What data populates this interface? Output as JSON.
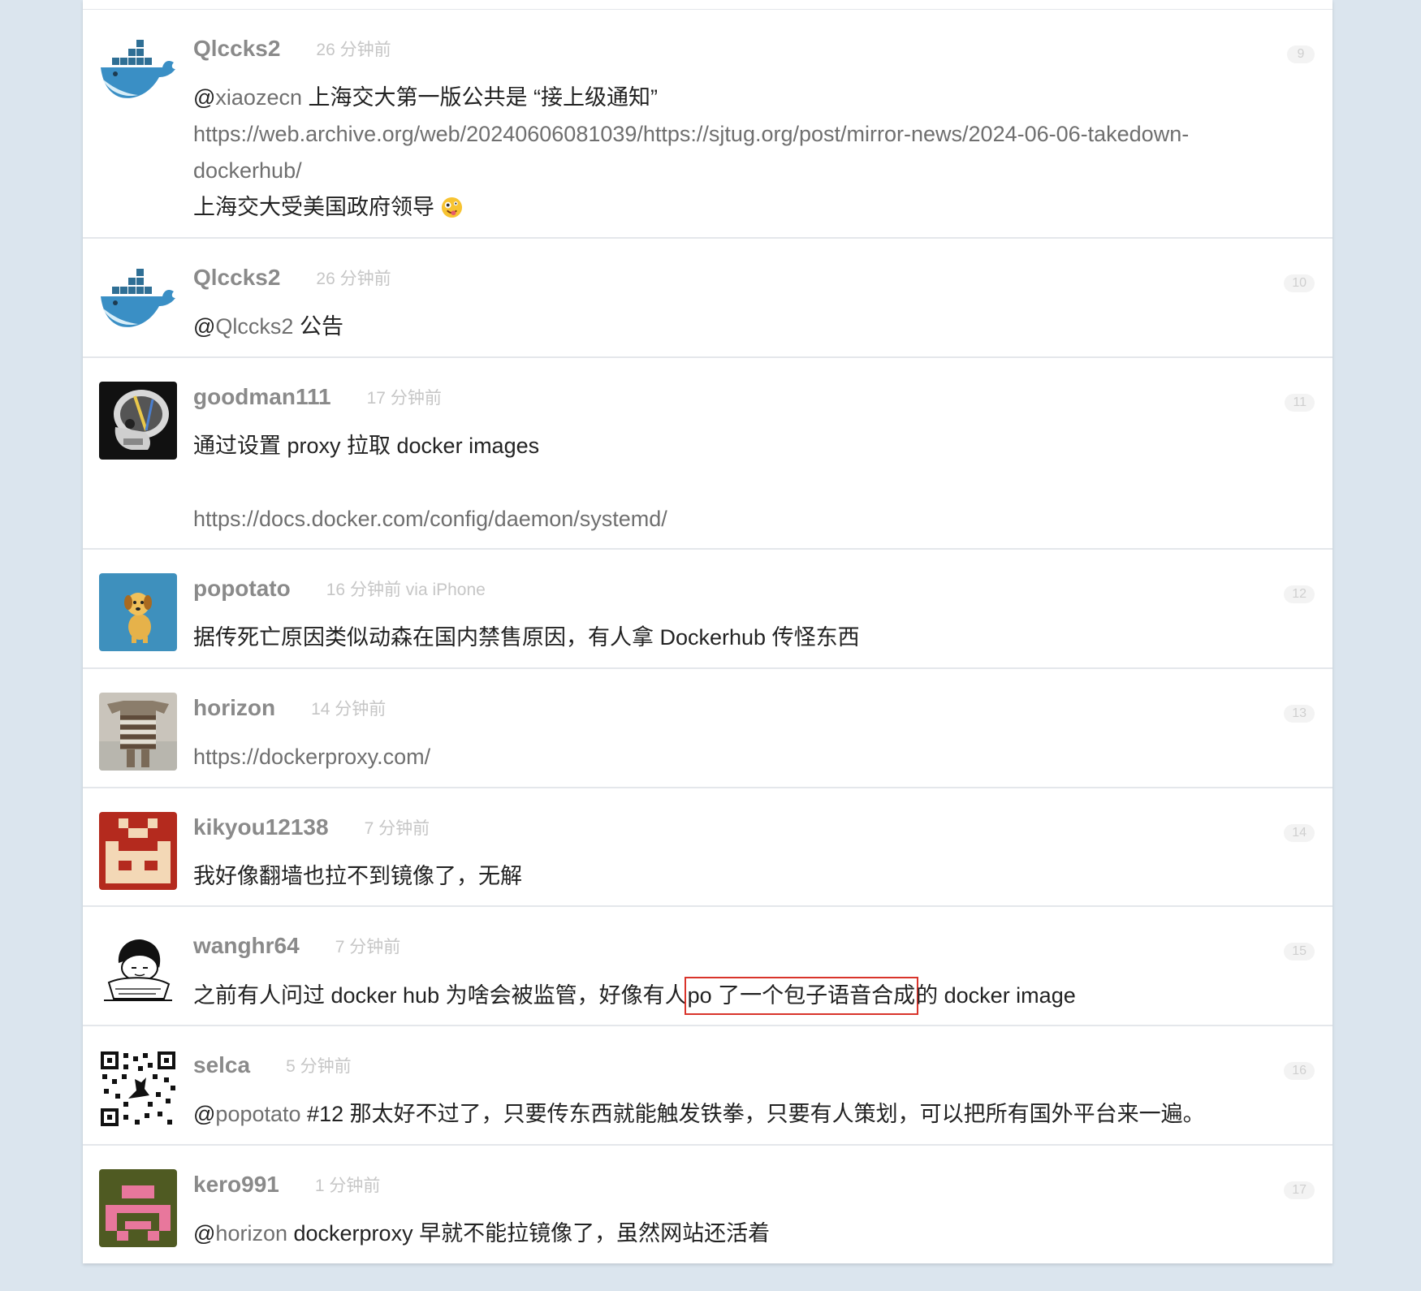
{
  "replies": [
    {
      "username": "Qlccks2",
      "time": "26 分钟前",
      "floor": "9",
      "mention": "xiaozecn",
      "text1": "上海交大第一版公共是 “接上级通知”",
      "link_part1": "https://web.archive.org/web/20240606081039/https://sjtug.org/post/mirror-news/2024-06-06-takedown-",
      "link_part2": "dockerhub/",
      "text2": "上海交大受美国政府领导"
    },
    {
      "username": "Qlccks2",
      "time": "26 分钟前",
      "floor": "10",
      "mention": "Qlccks2",
      "text": "公告"
    },
    {
      "username": "goodman111",
      "time": "17 分钟前",
      "floor": "11",
      "text": "通过设置 proxy 拉取 docker images",
      "link": "https://docs.docker.com/config/daemon/systemd/"
    },
    {
      "username": "popotato",
      "time": "16 分钟前 via iPhone",
      "floor": "12",
      "text": "据传死亡原因类似动森在国内禁售原因，有人拿 Dockerhub 传怪东西"
    },
    {
      "username": "horizon",
      "time": "14 分钟前",
      "floor": "13",
      "link": "https://dockerproxy.com/"
    },
    {
      "username": "kikyou12138",
      "time": "7 分钟前",
      "floor": "14",
      "text": "我好像翻墙也拉不到镜像了，无解"
    },
    {
      "username": "wanghr64",
      "time": "7 分钟前",
      "floor": "15",
      "text_before": "之前有人问过 docker hub 为啥会被监管，好像有人",
      "text_highlight": "po 了一个包子语音合成",
      "text_after": "的 docker image"
    },
    {
      "username": "selca",
      "time": "5 分钟前",
      "floor": "16",
      "mention": "popotato",
      "text": "#12 那太好不过了，只要传东西就能触发铁拳，只要有人策划，可以把所有国外平台来一遍。"
    },
    {
      "username": "kero991",
      "time": "1 分钟前",
      "floor": "17",
      "mention": "horizon",
      "text": "dockerproxy 早就不能拉镜像了，虽然网站还活着"
    }
  ]
}
